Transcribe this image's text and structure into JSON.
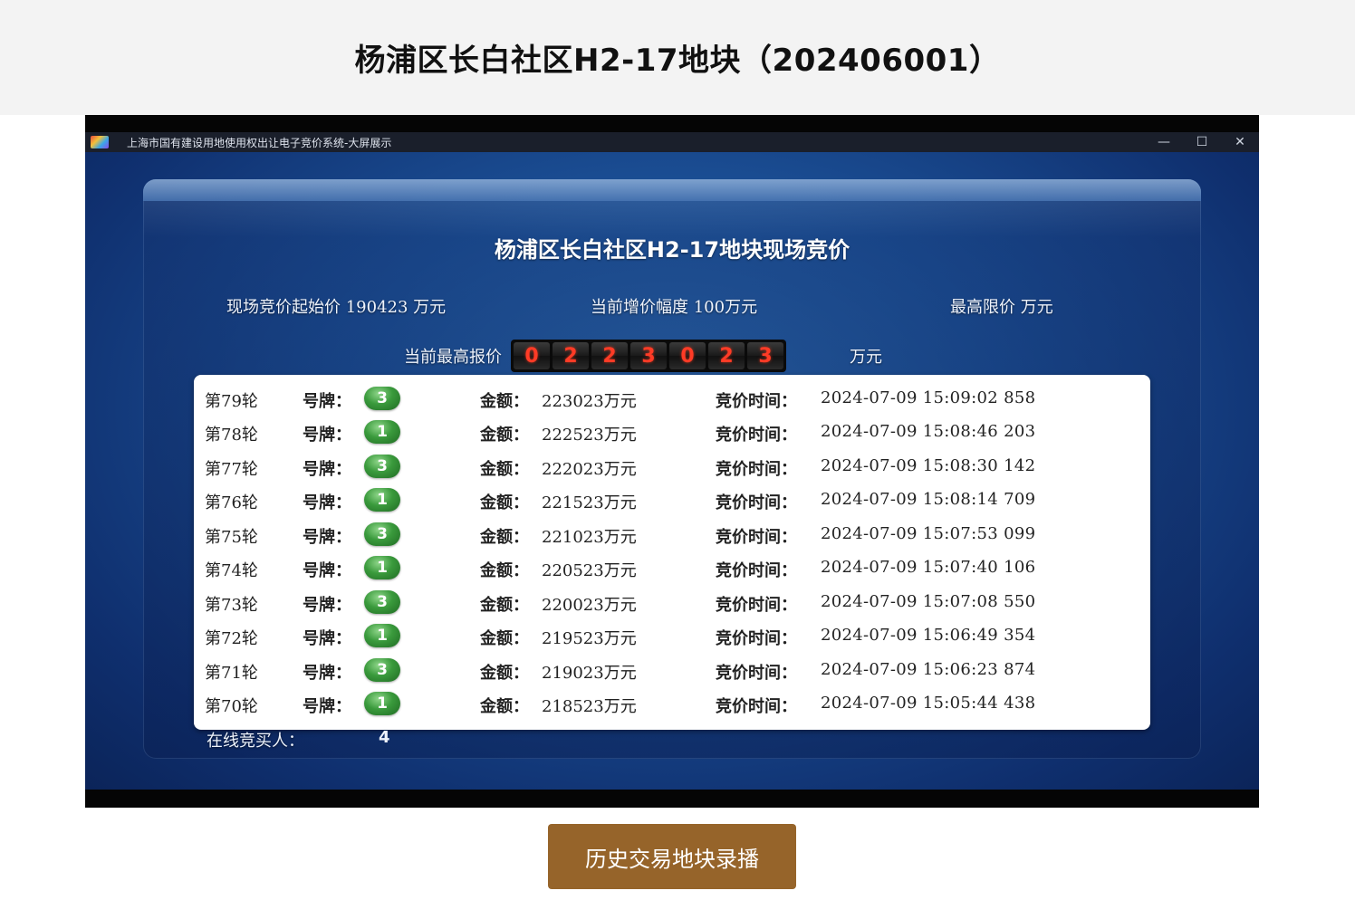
{
  "page": {
    "title": "杨浦区长白社区H2-17地块（202406001）"
  },
  "window": {
    "title": "上海市国有建设用地使用权出让电子竞价系统-大屏展示",
    "controls": {
      "minimize": "—",
      "maximize": "☐",
      "close": "✕"
    }
  },
  "auction": {
    "title": "杨浦区长白社区H2-17地块现场竞价",
    "start_price": "现场竞价起始价 190423 万元",
    "increment": "当前增价幅度 100万元",
    "price_cap": "最高限价 万元",
    "current_label": "当前最高报价",
    "current_digits": [
      "0",
      "2",
      "2",
      "3",
      "0",
      "2",
      "3"
    ],
    "current_unit": "万元",
    "online_label": "在线竞买人：",
    "online_count": "4"
  },
  "bid_labels": {
    "plate": "号牌：",
    "amount": "金额：",
    "time": "竞价时间："
  },
  "bids": [
    {
      "round": "第79轮",
      "plate": "3",
      "amount": "223023万元",
      "time": "2024-07-09 15:09:02 858"
    },
    {
      "round": "第78轮",
      "plate": "1",
      "amount": "222523万元",
      "time": "2024-07-09 15:08:46 203"
    },
    {
      "round": "第77轮",
      "plate": "3",
      "amount": "222023万元",
      "time": "2024-07-09 15:08:30 142"
    },
    {
      "round": "第76轮",
      "plate": "1",
      "amount": "221523万元",
      "time": "2024-07-09 15:08:14 709"
    },
    {
      "round": "第75轮",
      "plate": "3",
      "amount": "221023万元",
      "time": "2024-07-09 15:07:53 099"
    },
    {
      "round": "第74轮",
      "plate": "1",
      "amount": "220523万元",
      "time": "2024-07-09 15:07:40 106"
    },
    {
      "round": "第73轮",
      "plate": "3",
      "amount": "220023万元",
      "time": "2024-07-09 15:07:08 550"
    },
    {
      "round": "第72轮",
      "plate": "1",
      "amount": "219523万元",
      "time": "2024-07-09 15:06:49 354"
    },
    {
      "round": "第71轮",
      "plate": "3",
      "amount": "219023万元",
      "time": "2024-07-09 15:06:23 874"
    },
    {
      "round": "第70轮",
      "plate": "1",
      "amount": "218523万元",
      "time": "2024-07-09 15:05:44 438"
    }
  ],
  "history_button": {
    "label": "历史交易地块录播"
  },
  "colors": {
    "button": "#96642a",
    "digit_text": "#ff3b26",
    "plate": "#3a9a3c",
    "screen_bg": "#1b4f95"
  }
}
